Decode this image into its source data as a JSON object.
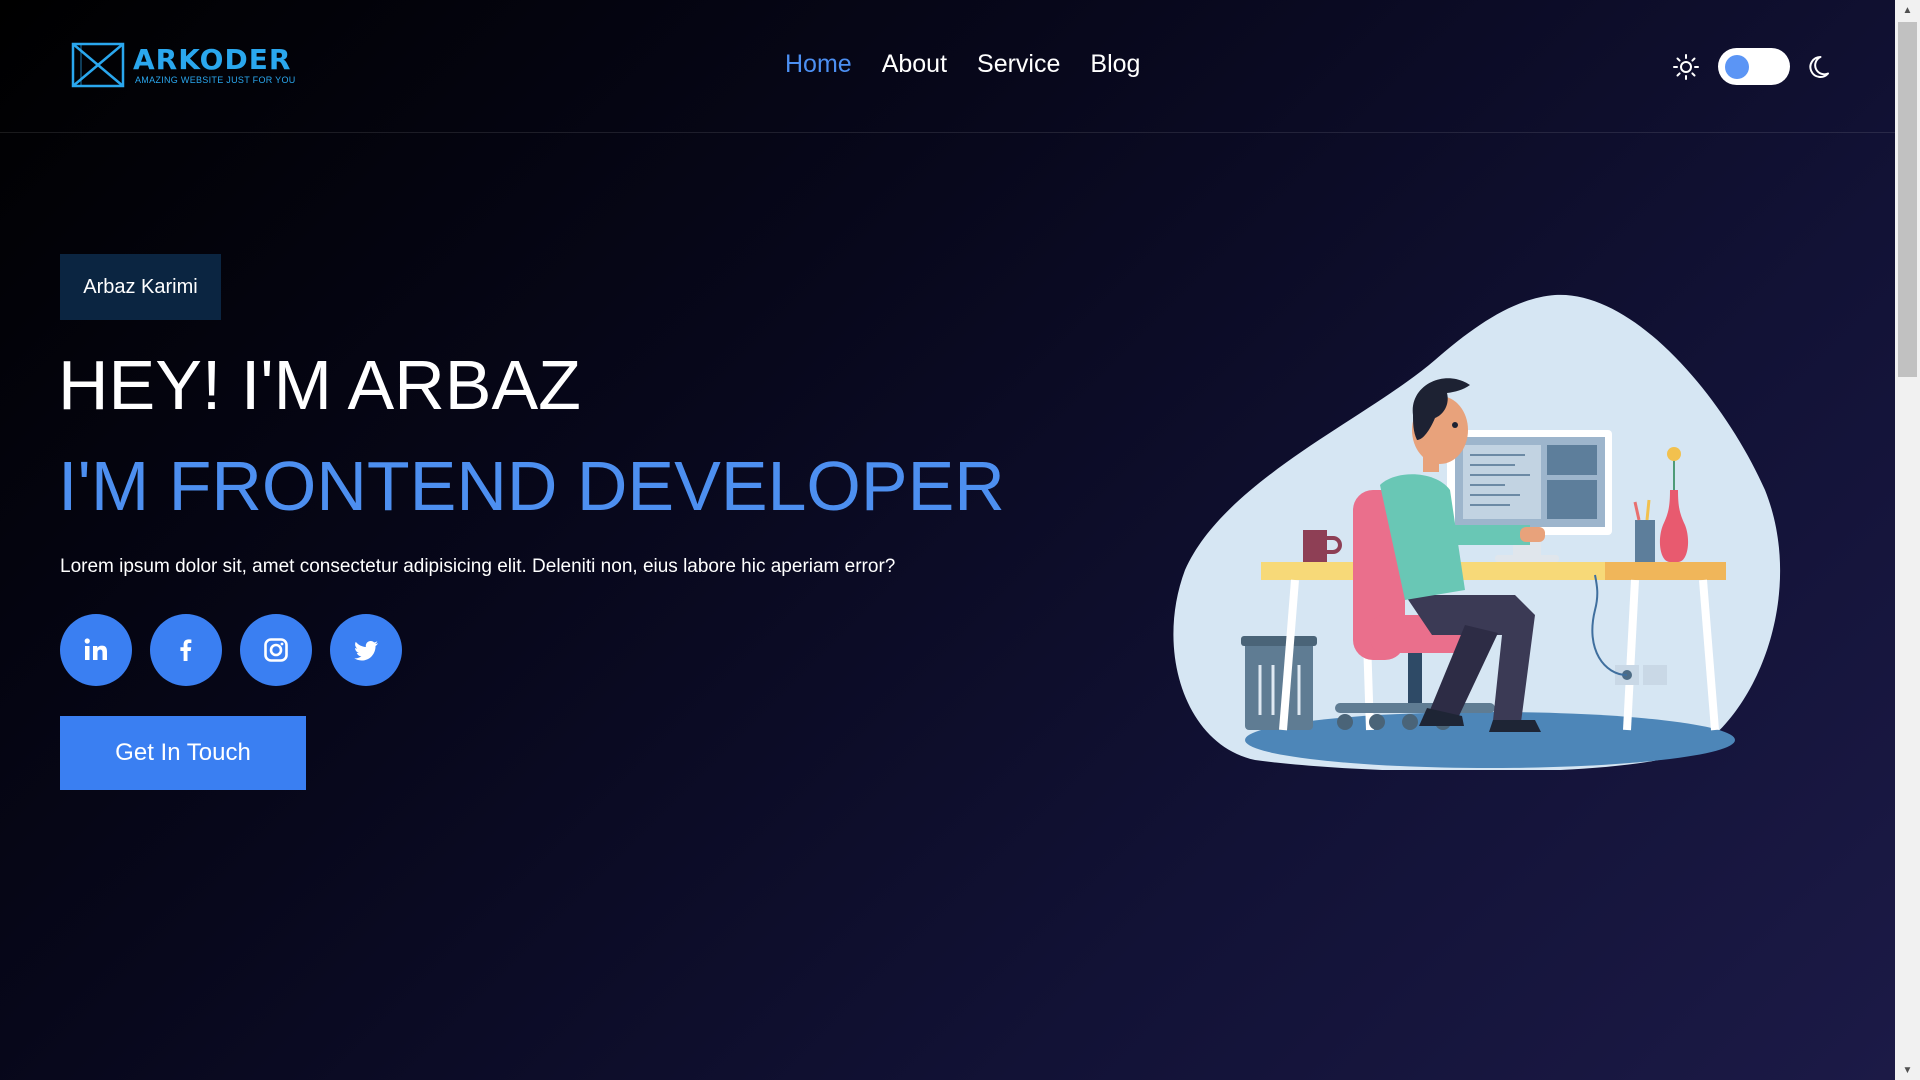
{
  "brand": {
    "name": "ARKODER",
    "tagline": "AMAZING WEBSITE JUST FOR YOU",
    "color": "#2aa7ee"
  },
  "nav": {
    "items": [
      {
        "label": "Home",
        "active": true
      },
      {
        "label": "About",
        "active": false
      },
      {
        "label": "Service",
        "active": false
      },
      {
        "label": "Blog",
        "active": false
      }
    ]
  },
  "theme_toggle": {
    "left_icon": "sun-icon",
    "right_icon": "moon-icon",
    "mode": "dark"
  },
  "hero": {
    "badge": "Arbaz Karimi",
    "title": "HEY! I'M ARBAZ",
    "subtitle": "I'M FRONTEND DEVELOPER",
    "description": "Lorem ipsum dolor sit, amet consectetur adipisicing elit. Deleniti non, eius labore hic aperiam error?",
    "socials": [
      {
        "icon": "linkedin-icon"
      },
      {
        "icon": "facebook-icon"
      },
      {
        "icon": "instagram-icon"
      },
      {
        "icon": "twitter-icon"
      }
    ],
    "cta_label": "Get In Touch"
  },
  "colors": {
    "accent": "#3a7ff2",
    "accent_text": "#4d8ff0",
    "badge_bg": "#0b2541",
    "blob": "#d6e6f3"
  }
}
